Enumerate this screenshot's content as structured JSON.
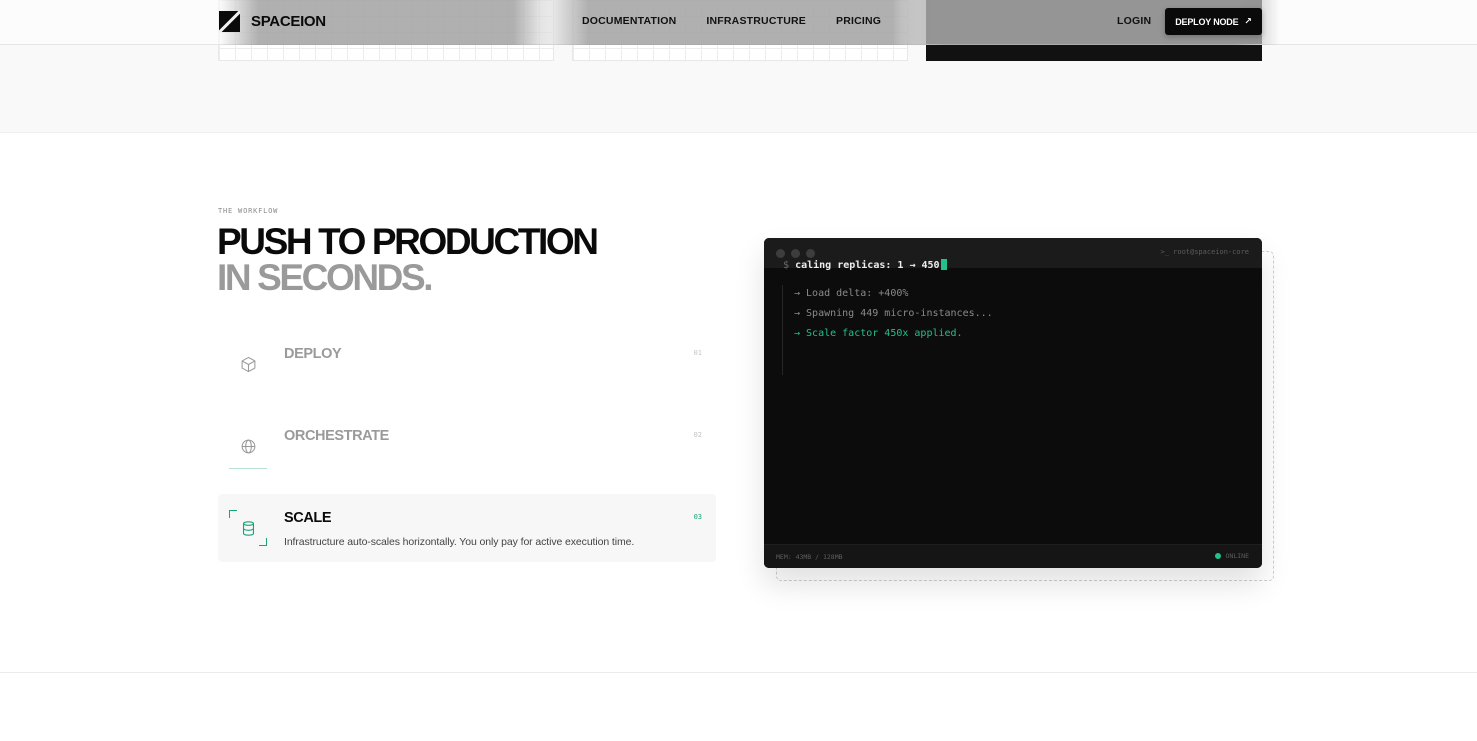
{
  "brand": {
    "name": "SPACEION"
  },
  "nav": {
    "items": [
      {
        "label": "DOCUMENTATION"
      },
      {
        "label": "INFRASTRUCTURE"
      },
      {
        "label": "PRICING"
      }
    ],
    "login_label": "LOGIN",
    "cta_label": "DEPLOY NODE",
    "cta_icon": "arrow-up-right-icon"
  },
  "workflow": {
    "eyebrow": "THE WORKFLOW",
    "headline_line1": "PUSH TO PRODUCTION",
    "headline_line2": "IN SECONDS.",
    "steps": [
      {
        "title": "DEPLOY",
        "number": "01",
        "icon": "box-icon",
        "active": false
      },
      {
        "title": "ORCHESTRATE",
        "number": "02",
        "icon": "globe-icon",
        "active": false
      },
      {
        "title": "SCALE",
        "number": "03",
        "icon": "database-icon",
        "active": true,
        "description": "Infrastructure auto-scales horizontally. You only pay for active execution time."
      }
    ]
  },
  "terminal": {
    "host": "root@spaceion-core",
    "prompt": "$",
    "command": "caling replicas: 1 → 450",
    "logs": [
      "→ Load delta: +400%",
      "→ Spawning 449 micro-instances...",
      "→ Scale factor 450x applied."
    ],
    "memory": "MEM: 43MB / 128MB",
    "status": "ONLINE"
  },
  "colors": {
    "accent": "#22c08a",
    "accent_dark": "#1aa37a",
    "text": "#0a0a0a",
    "muted": "#9a9a9a",
    "terminal_bg": "#0c0c0c"
  }
}
